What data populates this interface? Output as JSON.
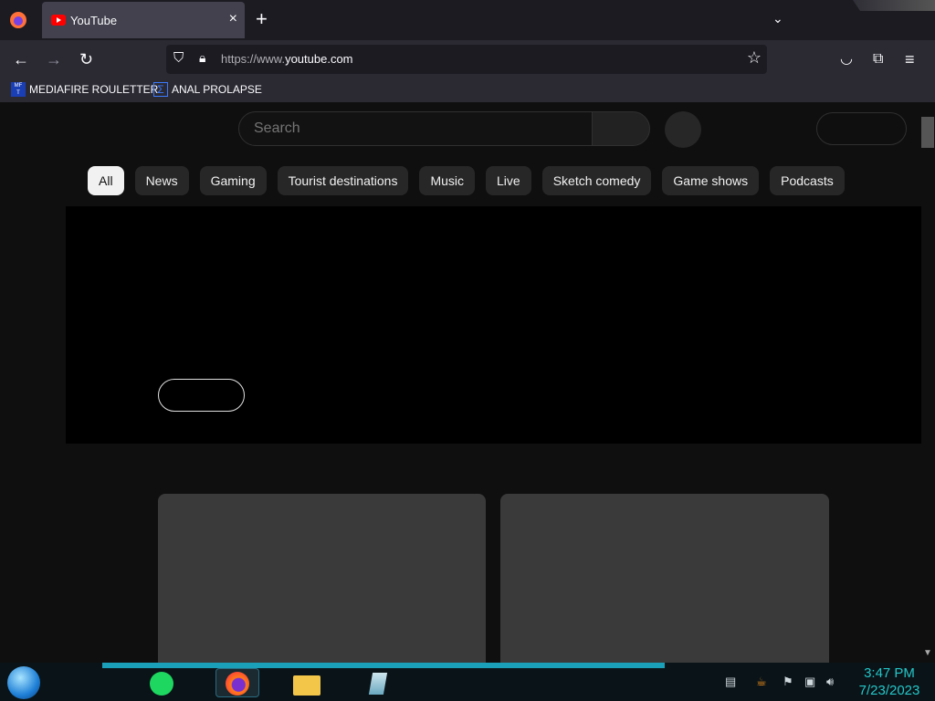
{
  "browser": {
    "tab": {
      "title": "YouTube",
      "close_glyph": "×"
    },
    "new_tab_glyph": "+",
    "tab_list_glyph": "⌄",
    "nav": {
      "back_glyph": "←",
      "forward_glyph": "→",
      "reload_glyph": "↻",
      "pocket_glyph": "◡",
      "extensions_glyph": "⧉",
      "menu_glyph": "≡"
    },
    "url": {
      "prefix": "https://www.",
      "domain": "youtube.com"
    },
    "bookmarks": [
      {
        "label": "MEDIAFIRE ROULETTER",
        "icon": "mf-icon"
      },
      {
        "label": "ANAL PROLAPSE",
        "icon": "sigma-icon"
      }
    ]
  },
  "youtube": {
    "search": {
      "placeholder": "Search"
    },
    "chips": [
      "All",
      "News",
      "Gaming",
      "Tourist destinations",
      "Music",
      "Live",
      "Sketch comedy",
      "Game shows",
      "Podcasts"
    ],
    "active_chip": "All"
  },
  "taskbar": {
    "clock": {
      "time": "3:47 PM",
      "date": "7/23/2023"
    },
    "apps": [
      "spotify-icon",
      "firefox-icon",
      "file-explorer-icon",
      "app-icon"
    ]
  },
  "colors": {
    "page_bg": "#0f0f0f",
    "chip_bg": "#272727",
    "active_chip_bg": "#f1f1f1",
    "clock": "#23c6c9"
  }
}
